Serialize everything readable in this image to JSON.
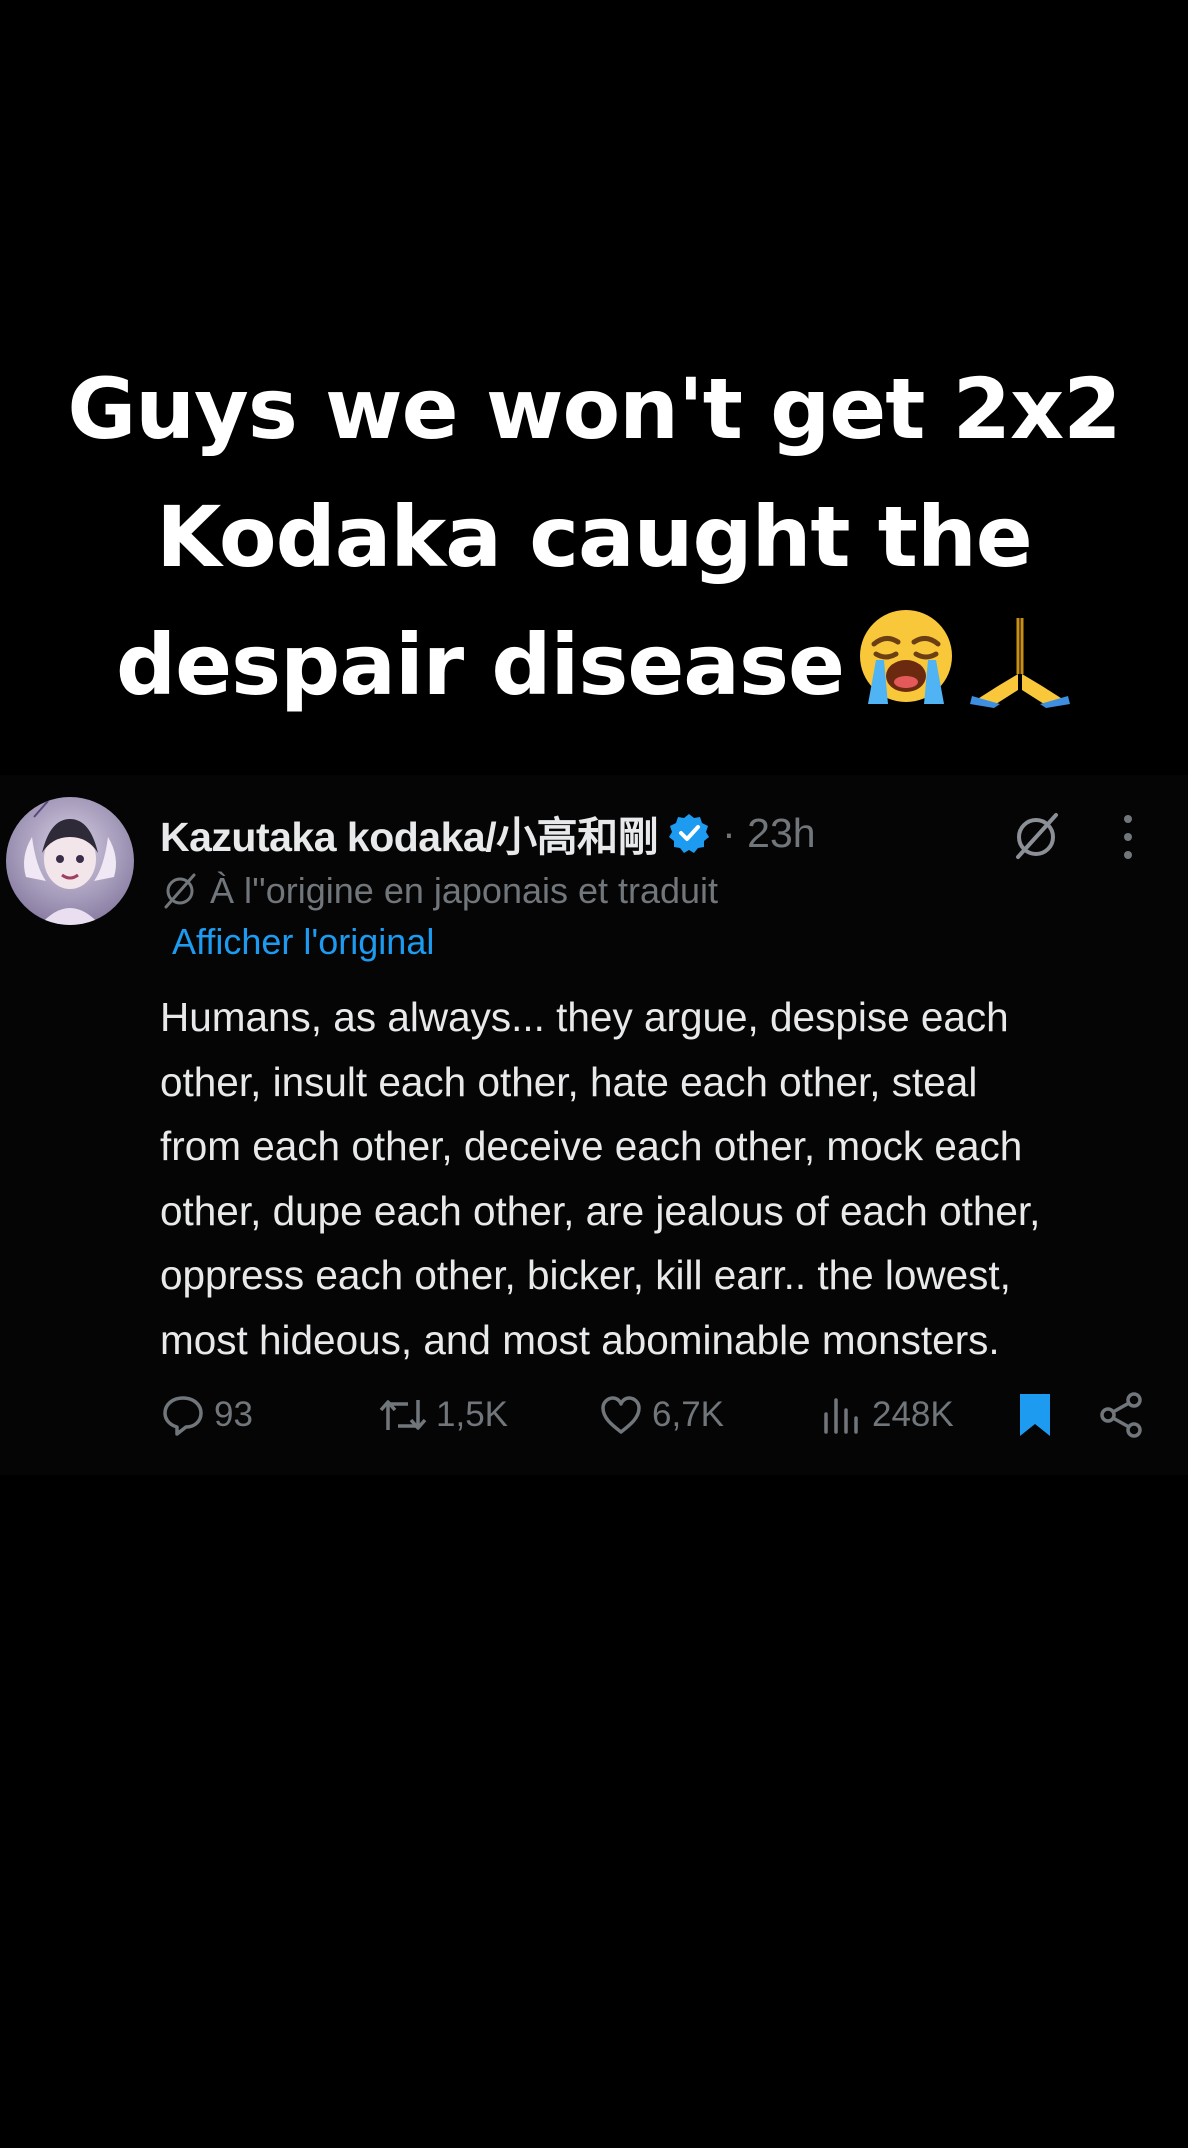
{
  "caption": {
    "line1": "Guys we won't get 2x2",
    "line2": "Kodaka caught the",
    "line3": "despair disease",
    "emojis": [
      "loudly-crying-face-icon",
      "folded-hands-icon"
    ]
  },
  "tweet": {
    "display_name": "Kazutaka kodaka/小高和剛",
    "timestamp": "· 23h",
    "translated_label": "À l''origine en japonais et traduit",
    "show_original": "Afficher l'original",
    "body_lines": [
      "Humans, as always... they argue, despise each",
      "other, insult each other, hate each other, steal",
      "from each other, deceive each other, mock each",
      "other, dupe each other, are jealous of each other,",
      "oppress each other, bicker, kill earr.. the lowest,",
      "most  hideous,  and most abominable monsters."
    ],
    "actions": {
      "replies": "93",
      "retweets": "1,5K",
      "likes": "6,7K",
      "views": "248K"
    }
  },
  "colors": {
    "background": "#000000",
    "tweet_background": "#050506",
    "primary_text": "#e7e9ea",
    "secondary_text": "#71767b",
    "accent_blue": "#1d9bf0"
  },
  "icons": [
    "verified-badge-icon",
    "grok-icon",
    "more-options-icon",
    "translate-slash-icon",
    "reply-icon",
    "retweet-icon",
    "like-icon",
    "views-icon",
    "bookmark-icon",
    "share-icon"
  ]
}
